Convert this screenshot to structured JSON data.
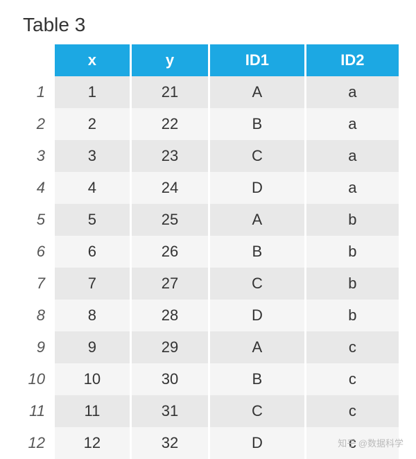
{
  "title": "Table 3",
  "columns": [
    "x",
    "y",
    "ID1",
    "ID2"
  ],
  "rows": [
    {
      "n": "1",
      "x": "1",
      "y": "21",
      "id1": "A",
      "id2": "a"
    },
    {
      "n": "2",
      "x": "2",
      "y": "22",
      "id1": "B",
      "id2": "a"
    },
    {
      "n": "3",
      "x": "3",
      "y": "23",
      "id1": "C",
      "id2": "a"
    },
    {
      "n": "4",
      "x": "4",
      "y": "24",
      "id1": "D",
      "id2": "a"
    },
    {
      "n": "5",
      "x": "5",
      "y": "25",
      "id1": "A",
      "id2": "b"
    },
    {
      "n": "6",
      "x": "6",
      "y": "26",
      "id1": "B",
      "id2": "b"
    },
    {
      "n": "7",
      "x": "7",
      "y": "27",
      "id1": "C",
      "id2": "b"
    },
    {
      "n": "8",
      "x": "8",
      "y": "28",
      "id1": "D",
      "id2": "b"
    },
    {
      "n": "9",
      "x": "9",
      "y": "29",
      "id1": "A",
      "id2": "c"
    },
    {
      "n": "10",
      "x": "10",
      "y": "30",
      "id1": "B",
      "id2": "c"
    },
    {
      "n": "11",
      "x": "11",
      "y": "31",
      "id1": "C",
      "id2": "c"
    },
    {
      "n": "12",
      "x": "12",
      "y": "32",
      "id1": "D",
      "id2": "c"
    }
  ],
  "watermark": "知乎 @数据科学"
}
